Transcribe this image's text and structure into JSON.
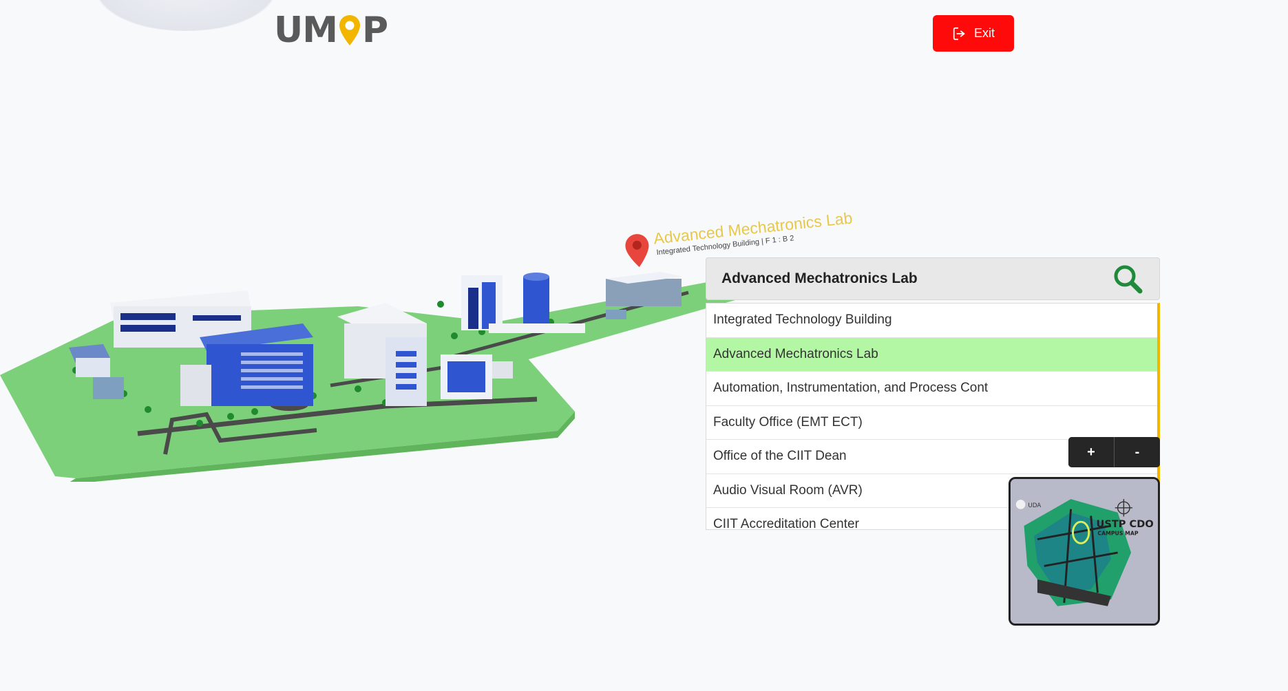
{
  "header": {
    "logo_left": "UM",
    "logo_right": "P",
    "exit_label": "Exit"
  },
  "map": {
    "marker_title": "Advanced Mechatronics Lab",
    "marker_subtitle": "Integrated Technology Building | F 1 : B 2"
  },
  "search": {
    "value": "Advanced Mechatronics Lab",
    "placeholder": ""
  },
  "results": {
    "items": [
      "Integrated Technology Building",
      "Advanced Mechatronics Lab",
      "Automation, Instrumentation, and Process Cont",
      "Faculty Office (EMT ECT)",
      "Office of the CIIT Dean",
      "Audio Visual Room (AVR)",
      "CIIT Accreditation Center"
    ],
    "selected_index": 1
  },
  "zoom": {
    "in_label": "+",
    "out_label": "-"
  },
  "minimap": {
    "title_line1": "USTP CDO",
    "title_line2": "CAMPUS MAP",
    "brand": "UDA"
  },
  "colors": {
    "exit": "#ff0a0a",
    "accent_pin": "#f2b500",
    "selected_row": "#b3f7a5",
    "search_icon": "#1e8a3a",
    "campus_grass": "#7dd07a"
  },
  "icons": {
    "exit": "exit-icon",
    "search": "search-icon",
    "marker": "map-pin-icon"
  }
}
